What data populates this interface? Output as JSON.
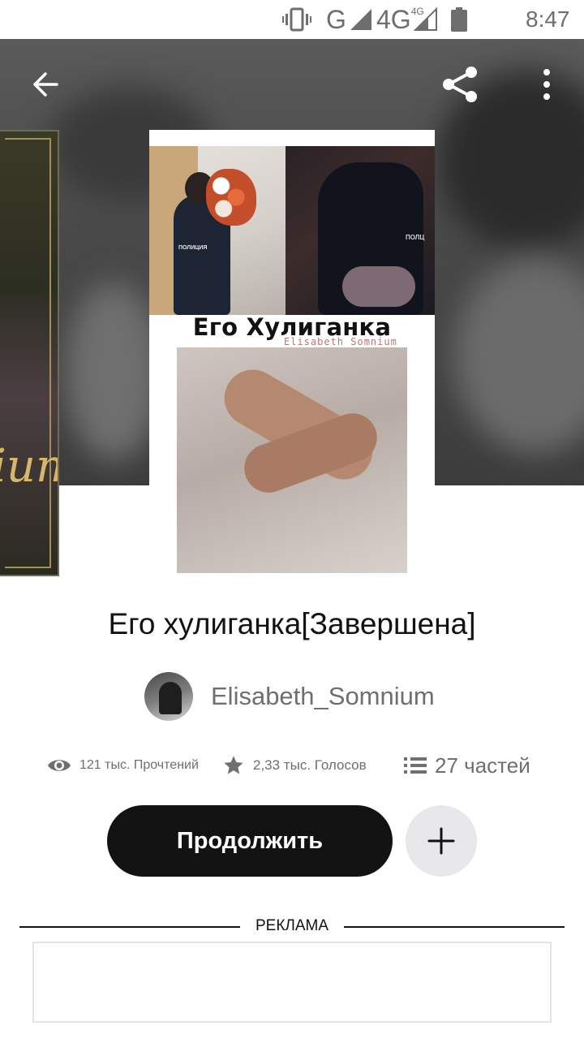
{
  "status_bar": {
    "network_g": "G",
    "network_4g": "4G",
    "network_4g_sup": "4G",
    "time": "8:47"
  },
  "toolbar": {
    "back_icon": "arrow-left-icon",
    "share_icon": "share-icon",
    "more_icon": "more-vertical-icon"
  },
  "cover": {
    "title_text": "Его Хулиганка",
    "author_text": "Elisabeth Somnium",
    "badge_left": "ПОЛИЦИЯ",
    "badge_right": "ПОЛЦ"
  },
  "story": {
    "title": "Его хулиганка[Завершена]",
    "author": "Elisabeth_Somnium"
  },
  "stats": {
    "reads": "121 тыс. Прочтений",
    "votes": "2,33 тыс. Голосов",
    "parts": "27 частей"
  },
  "actions": {
    "continue_label": "Продолжить",
    "add_icon": "plus-icon"
  },
  "ad": {
    "label": "РЕКЛАМА"
  },
  "colors": {
    "primary_button": "#121212",
    "secondary_button": "#e8e7e9",
    "muted_text": "#6f6f6f"
  }
}
